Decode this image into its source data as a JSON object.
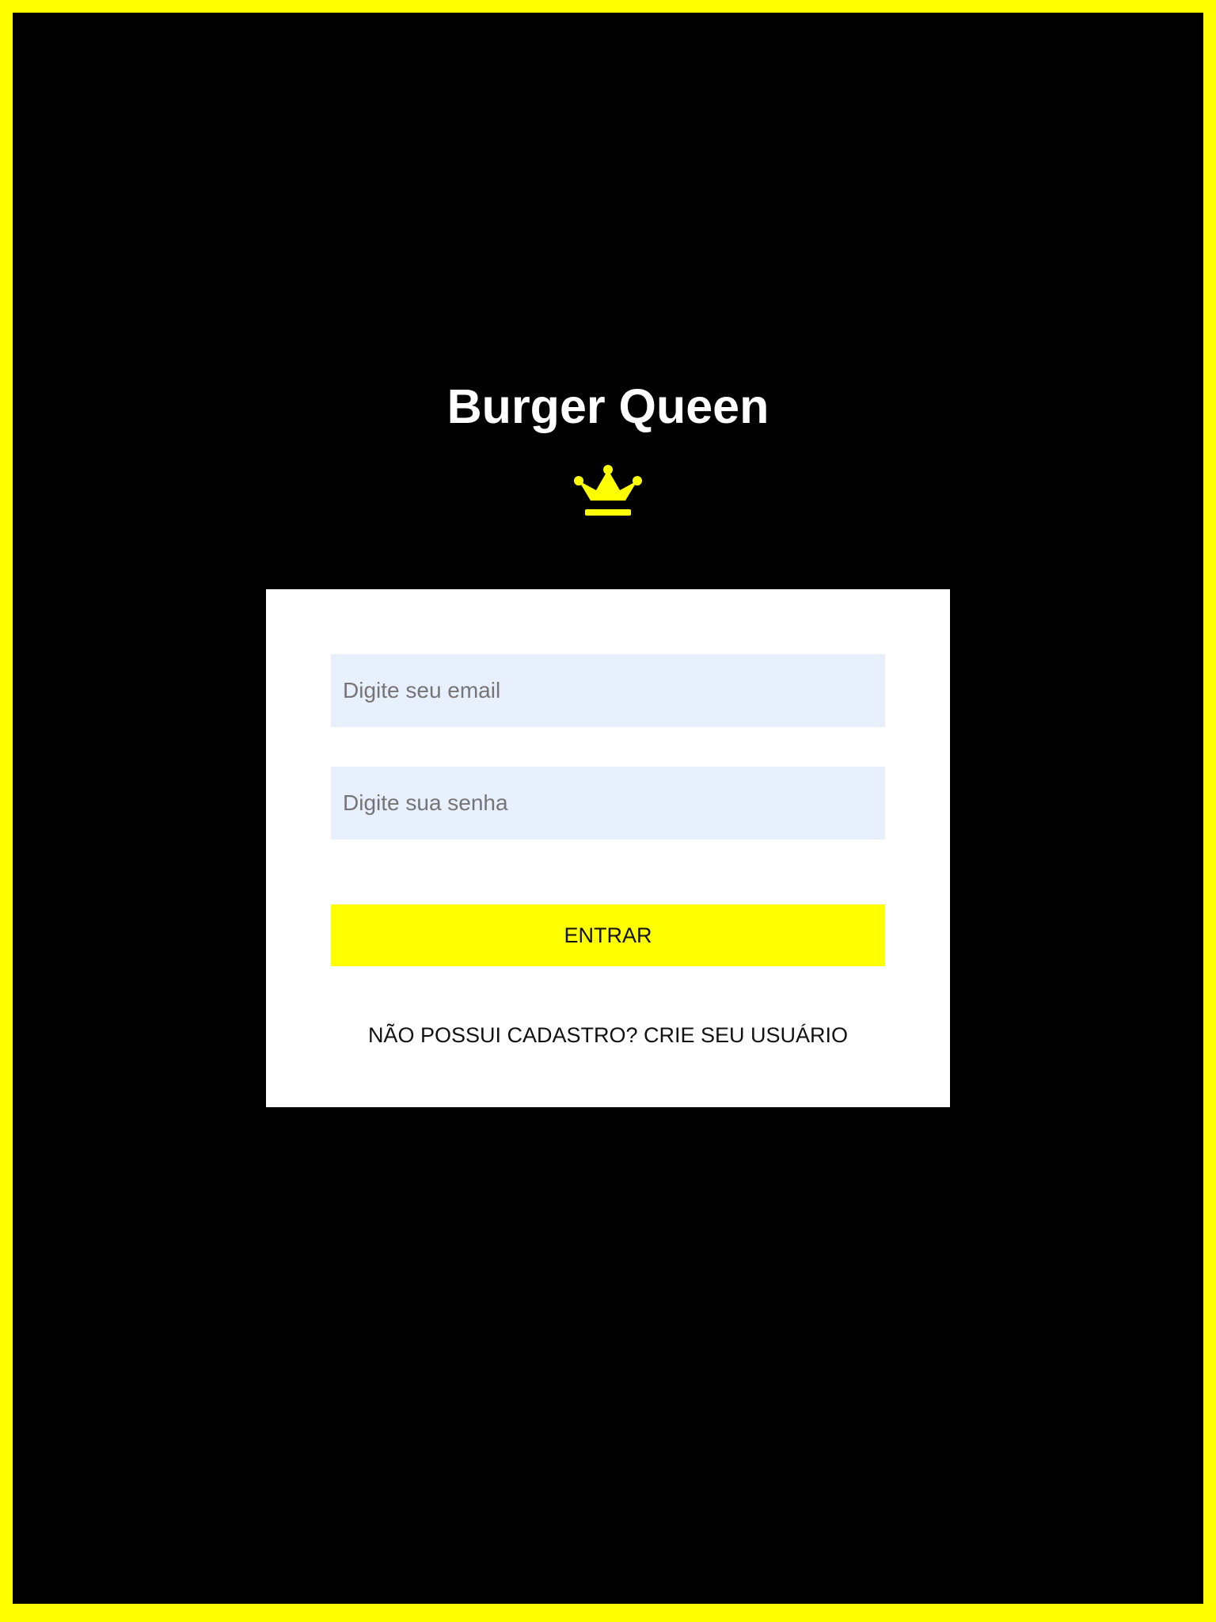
{
  "app": {
    "title": "Burger Queen"
  },
  "icons": {
    "brand": "crown-icon"
  },
  "colors": {
    "accent": "#ffff00",
    "background": "#000000",
    "card": "#ffffff",
    "input_background": "#e8f0fe"
  },
  "login_form": {
    "email_placeholder": "Digite seu email",
    "password_placeholder": "Digite sua senha",
    "submit_label": "ENTRAR",
    "signup_link_label": "NÃO POSSUI CADASTRO? CRIE SEU USUÁRIO"
  }
}
